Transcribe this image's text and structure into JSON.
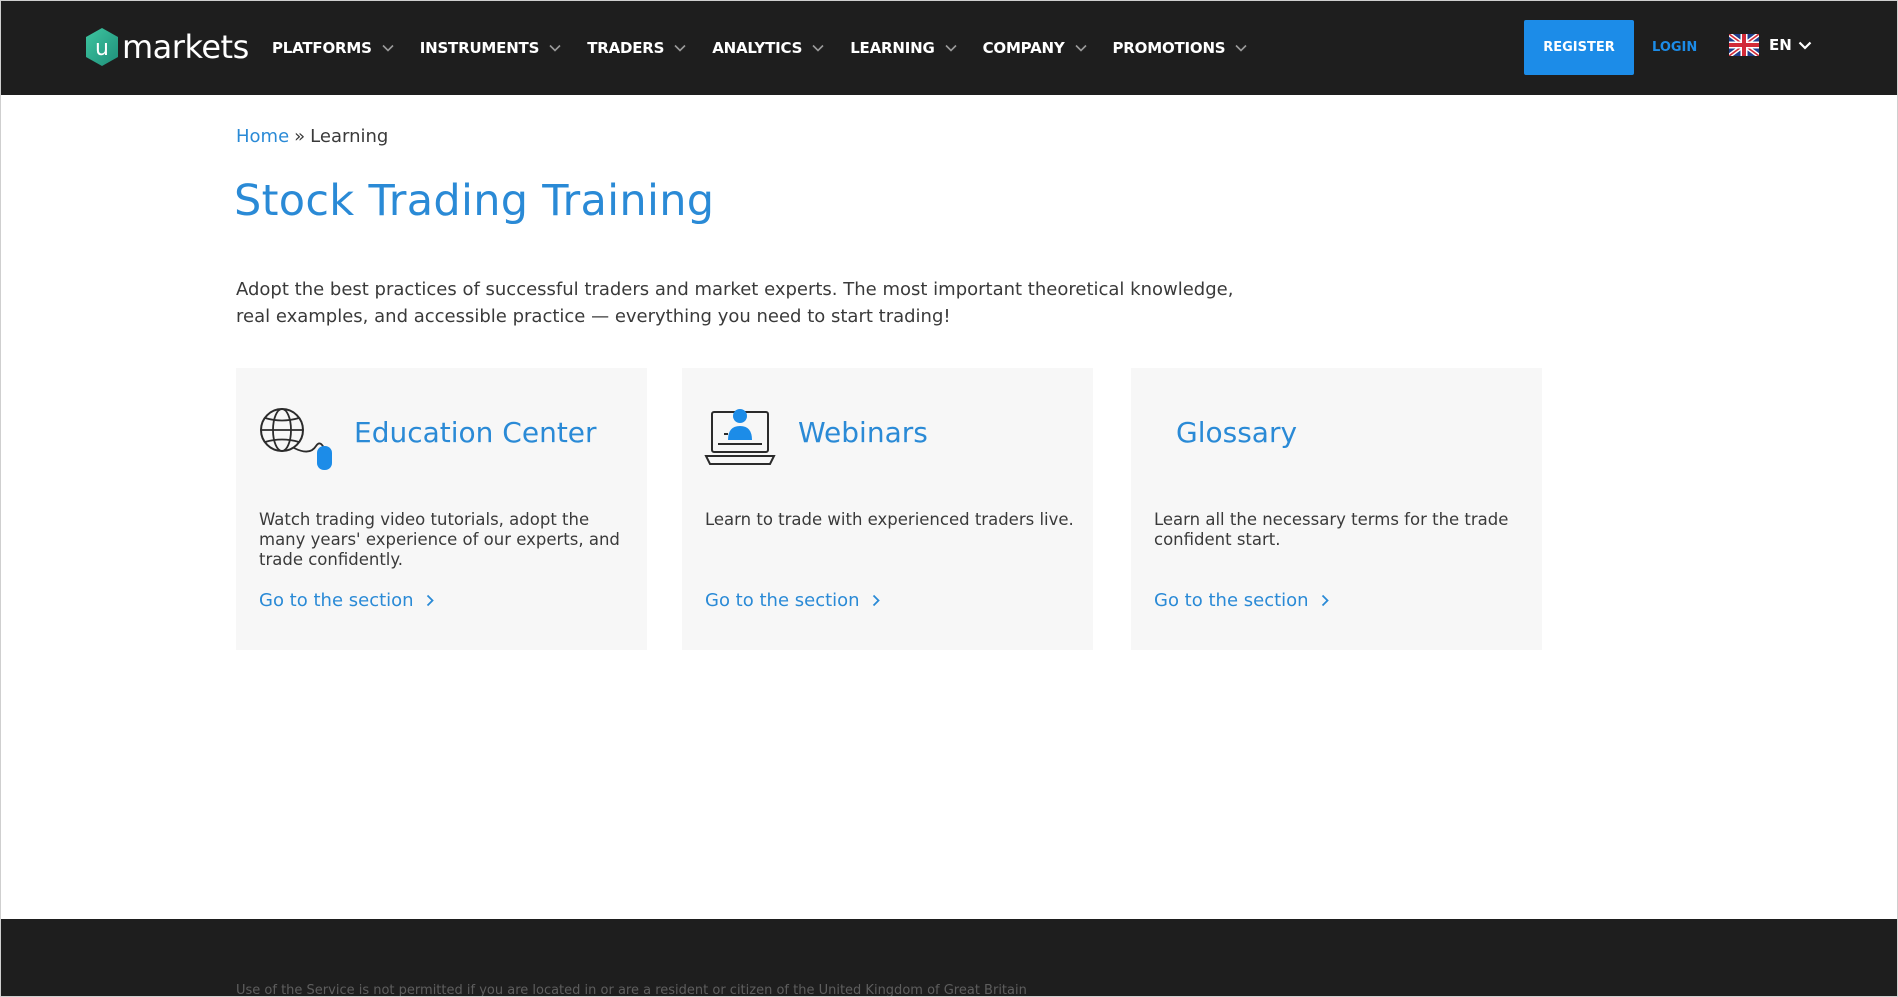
{
  "brand": {
    "logo_letter": "u",
    "logo_text": "markets",
    "logo_color": "#2fb08e"
  },
  "nav": {
    "items": [
      {
        "label": "PLATFORMS"
      },
      {
        "label": "INSTRUMENTS"
      },
      {
        "label": "TRADERS"
      },
      {
        "label": "ANALYTICS"
      },
      {
        "label": "LEARNING"
      },
      {
        "label": "COMPANY"
      },
      {
        "label": "PROMOTIONS"
      }
    ]
  },
  "header_actions": {
    "register_label": "REGISTER",
    "login_label": "LOGIN",
    "language_code": "EN",
    "language_flag_icon": "uk-flag-icon"
  },
  "breadcrumb": {
    "home": "Home",
    "separator": "»",
    "current": "Learning"
  },
  "page": {
    "title": "Stock Trading Training",
    "intro_line1": "Adopt the best practices of successful traders and market experts. The most important theoretical knowledge,",
    "intro_line2": "real examples, and accessible practice — everything you need to start trading!"
  },
  "cards": [
    {
      "title": "Education Center",
      "icon": "globe-mouse-icon",
      "description": "Watch trading video tutorials, adopt the many years' experience of our experts, and trade confidently.",
      "link": "Go to the section"
    },
    {
      "title": "Webinars",
      "icon": "laptop-presenter-icon",
      "description": "Learn to trade with experienced traders live.",
      "link": "Go to the section"
    },
    {
      "title": "Glossary",
      "icon": "",
      "description": "Learn all the necessary terms for the trade confident start.",
      "link": "Go to the section"
    }
  ],
  "footer": {
    "note": "Use of the Service is not permitted if you are located in or are a resident or citizen of the United Kingdom of Great Britain"
  },
  "colors": {
    "header_bg": "#1e1e1e",
    "accent": "#1c8ce8",
    "title_blue": "#2a8ad6",
    "card_bg": "#f7f7f7"
  }
}
